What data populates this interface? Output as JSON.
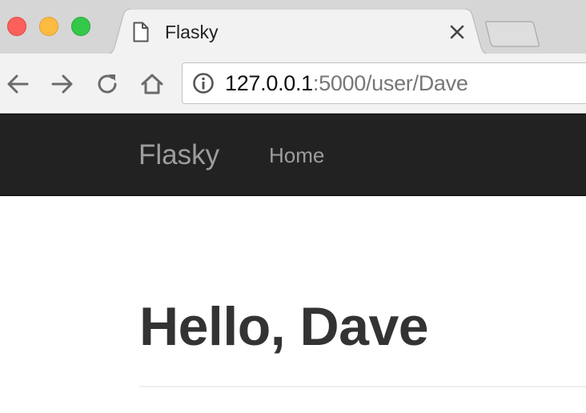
{
  "browser": {
    "tab": {
      "title": "Flasky"
    },
    "address_bar": {
      "host": "127.0.0.1",
      "path": ":5000/user/Dave"
    },
    "icons": {
      "tab_page": "page-icon",
      "tab_close": "close-icon",
      "new_tab": "new-tab-icon",
      "back": "back-arrow-icon",
      "forward": "forward-arrow-icon",
      "reload": "reload-icon",
      "home": "home-icon",
      "site_info": "info-icon"
    },
    "colors": {
      "close": "#fc605c",
      "minimize": "#fdbc40",
      "maximize": "#34c84a"
    }
  },
  "navbar": {
    "brand": "Flasky",
    "links": [
      {
        "label": "Home"
      }
    ],
    "background": "#222222",
    "link_color": "#9d9d9d"
  },
  "page": {
    "heading": "Hello, Dave"
  }
}
